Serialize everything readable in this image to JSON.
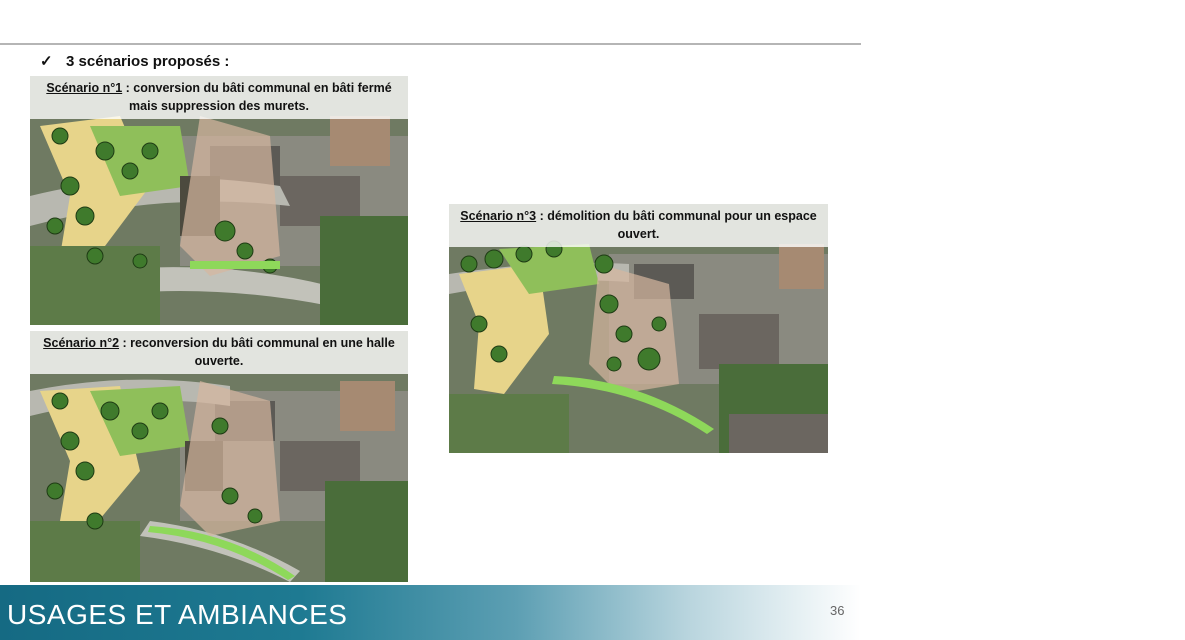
{
  "intro": {
    "text": "3 scénarios proposés :"
  },
  "scenarios": [
    {
      "label": "Scénario n°1",
      "description": " : conversion du bâti communal en bâti fermé mais suppression des murets."
    },
    {
      "label": "Scénario n°2",
      "description": " : reconversion du bâti communal en une halle ouverte."
    },
    {
      "label": "Scénario n°3",
      "description": " : démolition du bâti communal pour un espace ouvert."
    }
  ],
  "footer": {
    "title": "USAGES ET AMBIANCES",
    "page_number": "36"
  },
  "colors": {
    "footer_teal": "#156a83",
    "rule_gray": "#b5b5b5"
  },
  "icons": {
    "bullet": "checkmark-icon"
  }
}
